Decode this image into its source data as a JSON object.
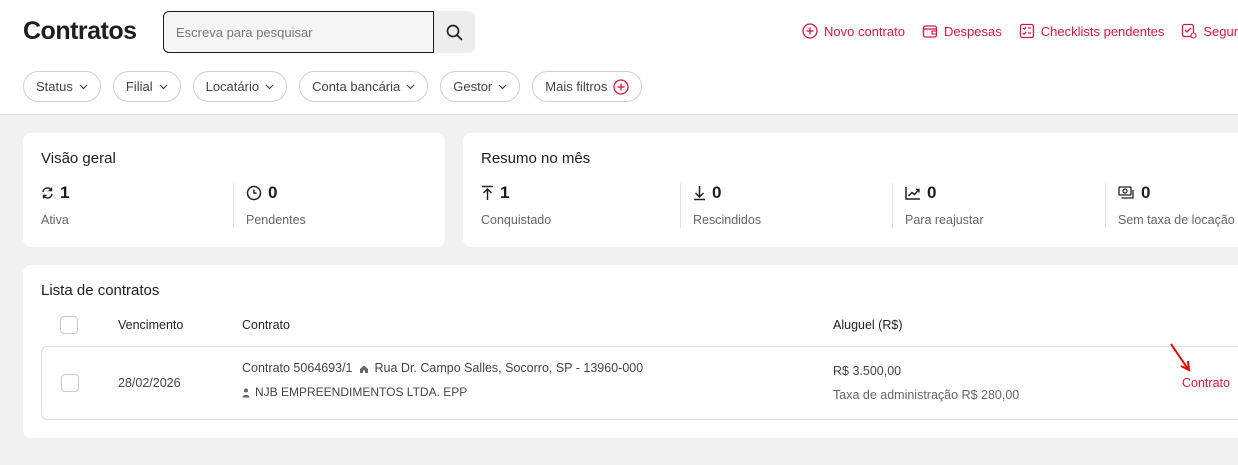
{
  "header": {
    "title": "Contratos",
    "search_placeholder": "Escreva para pesquisar",
    "actions": [
      {
        "label": "Novo contrato",
        "icon": "plus-circle-icon"
      },
      {
        "label": "Despesas",
        "icon": "wallet-icon"
      },
      {
        "label": "Checklists pendentes",
        "icon": "checklist-icon"
      },
      {
        "label": "Seguro",
        "icon": "insurance-icon"
      }
    ],
    "filters": [
      "Status",
      "Filial",
      "Locatário",
      "Conta bancária",
      "Gestor",
      "Mais filtros"
    ]
  },
  "overview": {
    "title": "Visão geral",
    "stats": [
      {
        "value": "1",
        "label": "Ativa",
        "icon": "refresh-icon"
      },
      {
        "value": "0",
        "label": "Pendentes",
        "icon": "clock-icon"
      }
    ]
  },
  "month_summary": {
    "title": "Resumo no mês",
    "stats": [
      {
        "value": "1",
        "label": "Conquistado",
        "icon": "arrow-up-icon"
      },
      {
        "value": "0",
        "label": "Rescindidos",
        "icon": "arrow-down-icon"
      },
      {
        "value": "0",
        "label": "Para reajustar",
        "icon": "trend-up-icon"
      },
      {
        "value": "0",
        "label": "Sem taxa de locação",
        "icon": "money-icon"
      }
    ]
  },
  "contract_list": {
    "title": "Lista de contratos",
    "columns": {
      "due": "Vencimento",
      "contract": "Contrato",
      "rent": "Aluguel (R$)"
    },
    "rows": [
      {
        "due_date": "28/02/2026",
        "contract_id": "Contrato 5064693/1",
        "address": "Rua Dr. Campo Salles, Socorro, SP - 13960-000",
        "tenant": "NJB EMPREENDIMENTOS LTDA. EPP",
        "rent": "R$ 3.500,00",
        "admin_fee": "Taxa de administração R$ 280,00",
        "link_label": "Contrato"
      }
    ]
  },
  "colors": {
    "accent": "#d8173e",
    "arrow": "#e00000"
  }
}
